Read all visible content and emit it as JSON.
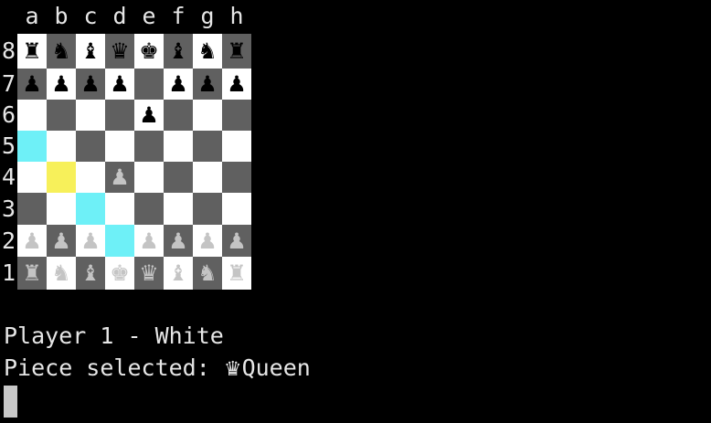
{
  "files": [
    "a",
    "b",
    "c",
    "d",
    "e",
    "f",
    "g",
    "h"
  ],
  "ranks": [
    "8",
    "7",
    "6",
    "5",
    "4",
    "3",
    "2",
    "1"
  ],
  "board": [
    [
      {
        "color": "light",
        "piece": "♜",
        "side": "black",
        "name": "rook"
      },
      {
        "color": "dark",
        "piece": "♞",
        "side": "black",
        "name": "knight"
      },
      {
        "color": "light",
        "piece": "♝",
        "side": "black",
        "name": "bishop"
      },
      {
        "color": "dark",
        "piece": "♛",
        "side": "black",
        "name": "queen"
      },
      {
        "color": "light",
        "piece": "♚",
        "side": "black",
        "name": "king"
      },
      {
        "color": "dark",
        "piece": "♝",
        "side": "black",
        "name": "bishop"
      },
      {
        "color": "light",
        "piece": "♞",
        "side": "black",
        "name": "knight"
      },
      {
        "color": "dark",
        "piece": "♜",
        "side": "black",
        "name": "rook"
      }
    ],
    [
      {
        "color": "dark",
        "piece": "♟",
        "side": "black",
        "name": "pawn"
      },
      {
        "color": "light",
        "piece": "♟",
        "side": "black",
        "name": "pawn"
      },
      {
        "color": "dark",
        "piece": "♟",
        "side": "black",
        "name": "pawn"
      },
      {
        "color": "light",
        "piece": "♟",
        "side": "black",
        "name": "pawn"
      },
      {
        "color": "dark",
        "piece": "",
        "side": "",
        "name": ""
      },
      {
        "color": "light",
        "piece": "♟",
        "side": "black",
        "name": "pawn"
      },
      {
        "color": "dark",
        "piece": "♟",
        "side": "black",
        "name": "pawn"
      },
      {
        "color": "light",
        "piece": "♟",
        "side": "black",
        "name": "pawn"
      }
    ],
    [
      {
        "color": "light",
        "piece": "",
        "side": "",
        "name": ""
      },
      {
        "color": "dark",
        "piece": "",
        "side": "",
        "name": ""
      },
      {
        "color": "light",
        "piece": "",
        "side": "",
        "name": ""
      },
      {
        "color": "dark",
        "piece": "",
        "side": "",
        "name": ""
      },
      {
        "color": "light",
        "piece": "♟",
        "side": "black",
        "name": "pawn"
      },
      {
        "color": "dark",
        "piece": "",
        "side": "",
        "name": ""
      },
      {
        "color": "light",
        "piece": "",
        "side": "",
        "name": ""
      },
      {
        "color": "dark",
        "piece": "",
        "side": "",
        "name": ""
      }
    ],
    [
      {
        "color": "move",
        "piece": "",
        "side": "",
        "name": ""
      },
      {
        "color": "light",
        "piece": "",
        "side": "",
        "name": ""
      },
      {
        "color": "dark",
        "piece": "",
        "side": "",
        "name": ""
      },
      {
        "color": "light",
        "piece": "",
        "side": "",
        "name": ""
      },
      {
        "color": "dark",
        "piece": "",
        "side": "",
        "name": ""
      },
      {
        "color": "light",
        "piece": "",
        "side": "",
        "name": ""
      },
      {
        "color": "dark",
        "piece": "",
        "side": "",
        "name": ""
      },
      {
        "color": "light",
        "piece": "",
        "side": "",
        "name": ""
      }
    ],
    [
      {
        "color": "light",
        "piece": "",
        "side": "",
        "name": ""
      },
      {
        "color": "selected",
        "piece": "",
        "side": "",
        "name": ""
      },
      {
        "color": "light",
        "piece": "",
        "side": "",
        "name": ""
      },
      {
        "color": "dark",
        "piece": "♟",
        "side": "white",
        "name": "pawn"
      },
      {
        "color": "light",
        "piece": "",
        "side": "",
        "name": ""
      },
      {
        "color": "dark",
        "piece": "",
        "side": "",
        "name": ""
      },
      {
        "color": "light",
        "piece": "",
        "side": "",
        "name": ""
      },
      {
        "color": "dark",
        "piece": "",
        "side": "",
        "name": ""
      }
    ],
    [
      {
        "color": "dark",
        "piece": "",
        "side": "",
        "name": ""
      },
      {
        "color": "light",
        "piece": "",
        "side": "",
        "name": ""
      },
      {
        "color": "move",
        "piece": "",
        "side": "",
        "name": ""
      },
      {
        "color": "light",
        "piece": "",
        "side": "",
        "name": ""
      },
      {
        "color": "dark",
        "piece": "",
        "side": "",
        "name": ""
      },
      {
        "color": "light",
        "piece": "",
        "side": "",
        "name": ""
      },
      {
        "color": "dark",
        "piece": "",
        "side": "",
        "name": ""
      },
      {
        "color": "light",
        "piece": "",
        "side": "",
        "name": ""
      }
    ],
    [
      {
        "color": "light",
        "piece": "♟",
        "side": "white",
        "name": "pawn"
      },
      {
        "color": "dark",
        "piece": "♟",
        "side": "white",
        "name": "pawn"
      },
      {
        "color": "light",
        "piece": "♟",
        "side": "white",
        "name": "pawn"
      },
      {
        "color": "move",
        "piece": "",
        "side": "",
        "name": ""
      },
      {
        "color": "light",
        "piece": "♟",
        "side": "white",
        "name": "pawn"
      },
      {
        "color": "dark",
        "piece": "♟",
        "side": "white",
        "name": "pawn"
      },
      {
        "color": "light",
        "piece": "♟",
        "side": "white",
        "name": "pawn"
      },
      {
        "color": "dark",
        "piece": "♟",
        "side": "white",
        "name": "pawn"
      }
    ],
    [
      {
        "color": "dark",
        "piece": "♜",
        "side": "white",
        "name": "rook"
      },
      {
        "color": "light",
        "piece": "♞",
        "side": "white",
        "name": "knight"
      },
      {
        "color": "dark",
        "piece": "♝",
        "side": "white",
        "name": "bishop"
      },
      {
        "color": "light",
        "piece": "♚",
        "side": "white",
        "name": "king"
      },
      {
        "color": "dark",
        "piece": "♛",
        "side": "white",
        "name": "queen"
      },
      {
        "color": "light",
        "piece": "♝",
        "side": "white",
        "name": "bishop"
      },
      {
        "color": "dark",
        "piece": "♞",
        "side": "white",
        "name": "knight"
      },
      {
        "color": "light",
        "piece": "♜",
        "side": "white",
        "name": "rook"
      }
    ]
  ],
  "status": {
    "player_line": "Player 1 - White",
    "selected_prefix": "Piece selected: ",
    "selected_glyph": "♛",
    "selected_name": "Queen"
  },
  "colors": {
    "background": "#000000",
    "light_square": "#ffffff",
    "dark_square": "#606060",
    "move_highlight": "#6ef0f7",
    "selected_highlight": "#f7f05a",
    "black_piece": "#000000",
    "white_piece": "#c4c4c4"
  }
}
